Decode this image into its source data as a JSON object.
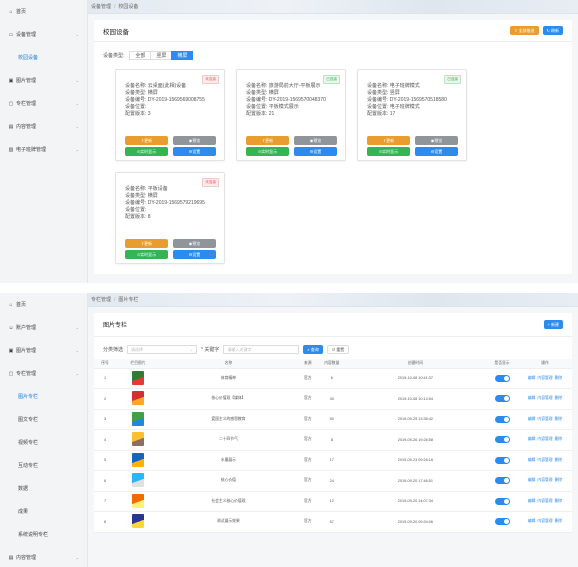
{
  "p1": {
    "sidebar": [
      {
        "label": "首页",
        "icon": "home-icon",
        "glyph": "⌂",
        "chev": false,
        "child": false,
        "active": false
      },
      {
        "label": "设备管理",
        "icon": "monitor-icon",
        "glyph": "▭",
        "chev": true,
        "child": false,
        "active": false
      },
      {
        "label": "校园设备",
        "icon": "",
        "glyph": "",
        "chev": false,
        "child": true,
        "active": true
      },
      {
        "label": "图片管理",
        "icon": "image-icon",
        "glyph": "▣",
        "chev": true,
        "child": false,
        "active": false
      },
      {
        "label": "专栏管理",
        "icon": "folder-icon",
        "glyph": "▢",
        "chev": true,
        "child": false,
        "active": false
      },
      {
        "label": "内容管理",
        "icon": "file-icon",
        "glyph": "▤",
        "chev": true,
        "child": false,
        "active": false
      },
      {
        "label": "电子班牌管理",
        "icon": "board-icon",
        "glyph": "▥",
        "chev": true,
        "child": false,
        "active": false
      }
    ],
    "breadcrumb": [
      "设备管理",
      "校园设备"
    ],
    "title": "校园设备",
    "btn_push": "全部推送",
    "btn_refresh": "刷新",
    "filter_label": "设备类型:",
    "filter_tabs": [
      "全部",
      "竖屏",
      "横屏"
    ],
    "devices": [
      {
        "status": "未连接",
        "on": false,
        "name": "设备名称: 云桌面(此相)设备",
        "type": "设备类型: 横屏",
        "sn": "设备编号: DY-2019-1569569008755",
        "pos": "设备位置:",
        "ver": "配置版本: 3"
      },
      {
        "status": "已连接",
        "on": true,
        "name": "设备名称: 旅游局前大厅-平板展示",
        "type": "设备类型: 横屏",
        "sn": "设备编号: DY-2019-1569570048370",
        "pos": "设备位置: 平板模式展示",
        "ver": "配置版本: 21"
      },
      {
        "status": "已连接",
        "on": true,
        "name": "设备名称: 电子班牌模式",
        "type": "设备类型: 竖屏",
        "sn": "设备编号: DY-2019-1569570518580",
        "pos": "设备位置: 电子班牌模式",
        "ver": "配置版本: 17"
      },
      {
        "status": "未连接",
        "on": false,
        "name": "设备名称: 平板设备",
        "type": "设备类型: 横屏",
        "sn": "设备编号: DY-2019-1569579219695",
        "pos": "设备位置:",
        "ver": "配置版本: 8"
      }
    ],
    "dev_btns": {
      "update": "更新",
      "preview": "预览",
      "realtime": "实时显示",
      "settings": "设置"
    }
  },
  "p2": {
    "sidebar": [
      {
        "label": "首页",
        "icon": "home-icon",
        "glyph": "⌂",
        "chev": false,
        "child": false,
        "active": false
      },
      {
        "label": "账户管理",
        "icon": "user-icon",
        "glyph": "☺",
        "chev": true,
        "child": false,
        "active": false
      },
      {
        "label": "图片管理",
        "icon": "image-icon",
        "glyph": "▣",
        "chev": true,
        "child": false,
        "active": false
      },
      {
        "label": "专栏管理",
        "icon": "folder-icon",
        "glyph": "▢",
        "chev": true,
        "child": false,
        "active": false
      },
      {
        "label": "图片专栏",
        "icon": "",
        "glyph": "",
        "chev": false,
        "child": true,
        "active": true
      },
      {
        "label": "图文专栏",
        "icon": "",
        "glyph": "",
        "chev": false,
        "child": true,
        "active": false
      },
      {
        "label": "视频专栏",
        "icon": "",
        "glyph": "",
        "chev": false,
        "child": true,
        "active": false
      },
      {
        "label": "互动专栏",
        "icon": "",
        "glyph": "",
        "chev": false,
        "child": true,
        "active": false
      },
      {
        "label": "数据",
        "icon": "",
        "glyph": "",
        "chev": false,
        "child": true,
        "active": false
      },
      {
        "label": "成果",
        "icon": "",
        "glyph": "",
        "chev": false,
        "child": true,
        "active": false
      },
      {
        "label": "系统说明专栏",
        "icon": "",
        "glyph": "",
        "chev": false,
        "child": true,
        "active": false
      },
      {
        "label": "内容管理",
        "icon": "file-icon",
        "glyph": "▤",
        "chev": true,
        "child": false,
        "active": false
      }
    ],
    "breadcrumb": [
      "专栏管理",
      "图片专栏"
    ],
    "title": "图片专栏",
    "btn_add": "+ 新建",
    "filter_label": "分类筛选",
    "filter_select": "请选择",
    "filter_kw": "* 关键字",
    "filter_input_ph": "请输入关键字",
    "btn_search": "查询",
    "btn_reset": "重置",
    "columns": [
      "序号",
      "栏目图片",
      "名称",
      "来源",
      "内容数量",
      "创建时间",
      "是否显示",
      "操作"
    ],
    "rows": [
      {
        "n": "1",
        "name": "体育精神",
        "src": "官方",
        "count": "6",
        "time": "2019-10-08 10:41:37",
        "c1": "#2e7d32",
        "c2": "#e53935"
      },
      {
        "n": "2",
        "name": "核心价值观【媒体】",
        "src": "官方",
        "count": "30",
        "time": "2019-10-08 10:14:54",
        "c1": "#d32f2f",
        "c2": "#f9a825"
      },
      {
        "n": "3",
        "name": "爱国主义的感恩教育",
        "src": "官方",
        "count": "50",
        "time": "2019-09-29 13:38:42",
        "c1": "#43a047",
        "c2": "#1e88e5"
      },
      {
        "n": "4",
        "name": "二十四节气",
        "src": "官方",
        "count": "8",
        "time": "2019-09-26 19:26:58",
        "c1": "#fbc02d",
        "c2": "#8d6e63"
      },
      {
        "n": "5",
        "name": "水墨展示",
        "src": "官方",
        "count": "17",
        "time": "2019-09-23 09:26:16",
        "c1": "#1565c0",
        "c2": "#ffb300"
      },
      {
        "n": "6",
        "name": "核心价值",
        "src": "官方",
        "count": "24",
        "time": "2019-09-20 17:46:51",
        "c1": "#29b6f6",
        "c2": "#e0e0e0"
      },
      {
        "n": "7",
        "name": "社会主义核心价值观",
        "src": "官方",
        "count": "12",
        "time": "2019-09-20 14:07:34",
        "c1": "#ef6c00",
        "c2": "#fff176"
      },
      {
        "n": "8",
        "name": "测试展示效果",
        "src": "官方",
        "count": "57",
        "time": "2019-09-20 09:34:06",
        "c1": "#283593",
        "c2": "#fdd835"
      }
    ],
    "ops": [
      "编辑",
      "内容管理",
      "删除"
    ]
  }
}
